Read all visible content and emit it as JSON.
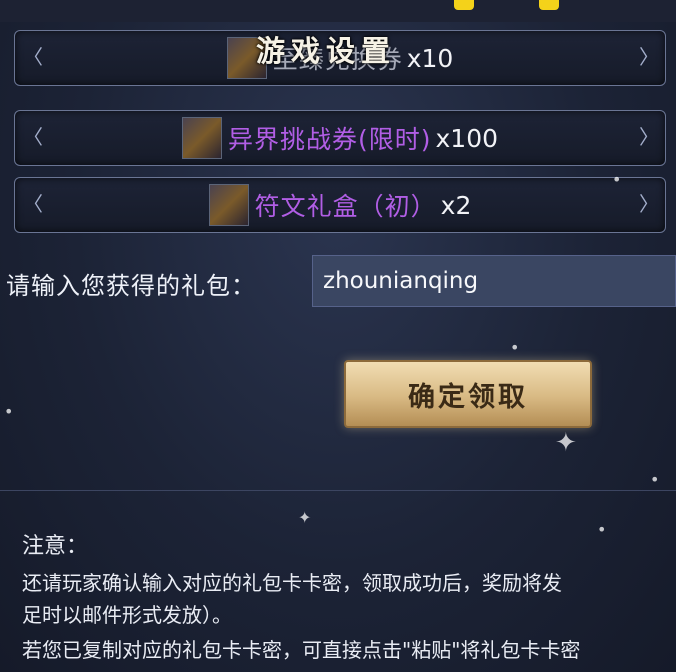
{
  "header": {
    "title": "游戏设置"
  },
  "rewards": [
    {
      "name": "至臻兑换券",
      "qty": "x10",
      "color": "#a6aab8"
    },
    {
      "name": "异界挑战券(限时)",
      "qty": "x100",
      "color": "#b15ee5"
    },
    {
      "name": "符文礼盒（初）",
      "qty": "x2",
      "color": "#b15ee5"
    }
  ],
  "gift": {
    "label": "请输入您获得的礼包：",
    "input_value": "zhounianqing",
    "confirm_label": "确定领取"
  },
  "notice": {
    "title": "注意：",
    "lines": [
      "还请玩家确认输入对应的礼包卡卡密，领取成功后，奖励将发",
      "足时以邮件形式发放）。",
      "若您已复制对应的礼包卡卡密，可直接点击\"粘贴\"将礼包卡卡密"
    ]
  },
  "colors": {
    "accent_gold": "#d8b983",
    "purple_text": "#b15ee5",
    "input_bg": "#3a4662"
  }
}
